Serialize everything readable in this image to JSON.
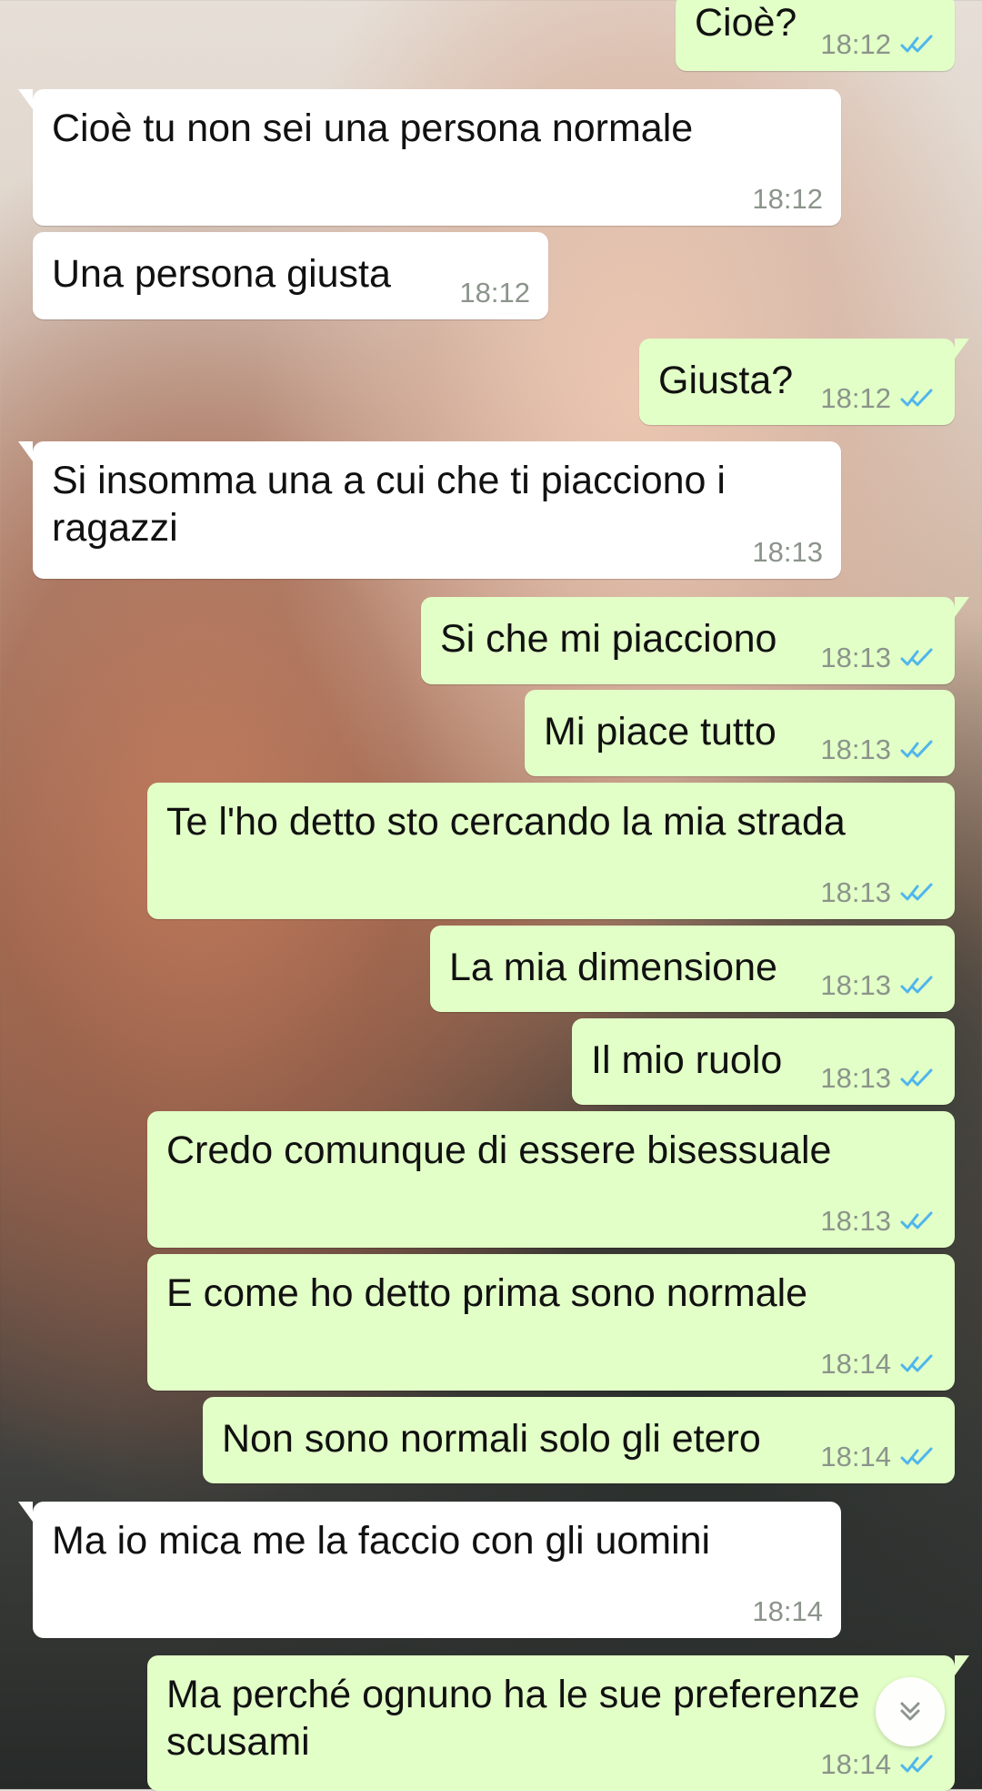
{
  "messages": [
    {
      "direction": "outgoing",
      "text": "Cioè?",
      "time": "18:12",
      "status_icon": "double-check-icon"
    },
    {
      "direction": "incoming",
      "text": "Cioè tu non sei una persona normale",
      "time": "18:12"
    },
    {
      "direction": "incoming",
      "text": "Una persona giusta",
      "time": "18:12"
    },
    {
      "direction": "outgoing",
      "text": "Giusta?",
      "time": "18:12",
      "status_icon": "double-check-icon"
    },
    {
      "direction": "incoming",
      "text": "Si insomma una a cui che ti piacciono i\nragazzi",
      "time": "18:13"
    },
    {
      "direction": "outgoing",
      "text": "Si che mi piacciono",
      "time": "18:13",
      "status_icon": "double-check-icon"
    },
    {
      "direction": "outgoing",
      "text": "Mi piace tutto",
      "time": "18:13",
      "status_icon": "double-check-icon"
    },
    {
      "direction": "outgoing",
      "text": "Te l'ho detto sto cercando la mia strada",
      "time": "18:13",
      "status_icon": "double-check-icon"
    },
    {
      "direction": "outgoing",
      "text": "La mia dimensione",
      "time": "18:13",
      "status_icon": "double-check-icon"
    },
    {
      "direction": "outgoing",
      "text": "Il mio ruolo",
      "time": "18:13",
      "status_icon": "double-check-icon"
    },
    {
      "direction": "outgoing",
      "text": "Credo comunque di essere bisessuale",
      "time": "18:13",
      "status_icon": "double-check-icon"
    },
    {
      "direction": "outgoing",
      "text": "E come ho detto prima sono normale",
      "time": "18:14",
      "status_icon": "double-check-icon"
    },
    {
      "direction": "outgoing",
      "text": "Non sono normali solo gli etero",
      "time": "18:14",
      "status_icon": "double-check-icon"
    },
    {
      "direction": "incoming",
      "text": "Ma io mica me la faccio con gli uomini",
      "time": "18:14"
    },
    {
      "direction": "outgoing",
      "text": "Ma perché ognuno ha le sue preferenze\nscusami",
      "time": "18:14",
      "status_icon": "double-check-icon"
    }
  ],
  "ui": {
    "scroll_button_icon": "chevron-double-down-icon",
    "colors": {
      "incoming_bubble": "#ffffff",
      "outgoing_bubble": "#e2ffc7",
      "meta_text": "#8b948b",
      "read_receipt": "#4fb6ec"
    }
  }
}
